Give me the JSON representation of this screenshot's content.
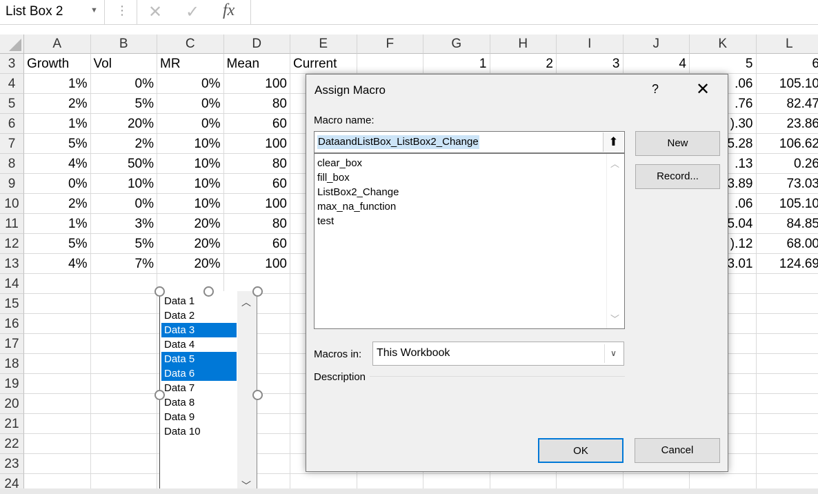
{
  "name_box": "List Box 2",
  "formula_bar": {
    "cancel_icon": "✕",
    "enter_icon": "✓",
    "fx_label": "fx"
  },
  "columns": [
    "A",
    "B",
    "C",
    "D",
    "E",
    "F",
    "G",
    "H",
    "I",
    "J",
    "K",
    "L"
  ],
  "row_numbers": [
    "3",
    "4",
    "5",
    "6",
    "7",
    "8",
    "9",
    "10",
    "11",
    "12",
    "13",
    "14",
    "15",
    "16",
    "17",
    "18",
    "19",
    "20",
    "21",
    "22",
    "23",
    "24"
  ],
  "headers_row3": {
    "A": "Growth",
    "B": "Vol",
    "C": "MR",
    "D": "Mean",
    "E": "Current",
    "G": "1",
    "H": "2",
    "I": "3",
    "J": "4",
    "K": "5",
    "L": "6"
  },
  "table_rows": [
    {
      "A": "1%",
      "B": "0%",
      "C": "0%",
      "D": "100",
      "K": ".06",
      "L": "105.10"
    },
    {
      "A": "2%",
      "B": "5%",
      "C": "0%",
      "D": "80",
      "K": ".76",
      "L": "82.47"
    },
    {
      "A": "1%",
      "B": "20%",
      "C": "0%",
      "D": "60",
      "K": ").30",
      "L": "23.86"
    },
    {
      "A": "5%",
      "B": "2%",
      "C": "10%",
      "D": "100",
      "K": "5.28",
      "L": "106.62"
    },
    {
      "A": "4%",
      "B": "50%",
      "C": "10%",
      "D": "80",
      "K": ".13",
      "L": "0.26"
    },
    {
      "A": "0%",
      "B": "10%",
      "C": "10%",
      "D": "60",
      "K": "3.89",
      "L": "73.03"
    },
    {
      "A": "2%",
      "B": "0%",
      "C": "10%",
      "D": "100",
      "K": ".06",
      "L": "105.10"
    },
    {
      "A": "1%",
      "B": "3%",
      "C": "20%",
      "D": "80",
      "K": "5.04",
      "L": "84.85"
    },
    {
      "A": "5%",
      "B": "5%",
      "C": "20%",
      "D": "60",
      "K": ").12",
      "L": "68.00"
    },
    {
      "A": "4%",
      "B": "7%",
      "C": "20%",
      "D": "100",
      "K": "3.01",
      "L": "124.69"
    }
  ],
  "listbox": {
    "items": [
      "Data 1",
      "Data 2",
      "Data 3",
      "Data 4",
      "Data 5",
      "Data 6",
      "Data 7",
      "Data 8",
      "Data 9",
      "Data 10"
    ],
    "selected": [
      "Data 3",
      "Data 5",
      "Data 6"
    ],
    "selection_color": "#0078d7"
  },
  "dialog": {
    "title": "Assign Macro",
    "help": "?",
    "close": "✕",
    "macro_name_label": "Macro name:",
    "macro_name_value": "DataandListBox_ListBox2_Change",
    "macros": [
      "clear_box",
      "fill_box",
      "ListBox2_Change",
      "max_na_function",
      "test"
    ],
    "new_button": "New",
    "record_button": "Record...",
    "macros_in_label": "Macros in:",
    "macros_in_value": "This Workbook",
    "description_label": "Description",
    "ok_button": "OK",
    "cancel_button": "Cancel"
  }
}
